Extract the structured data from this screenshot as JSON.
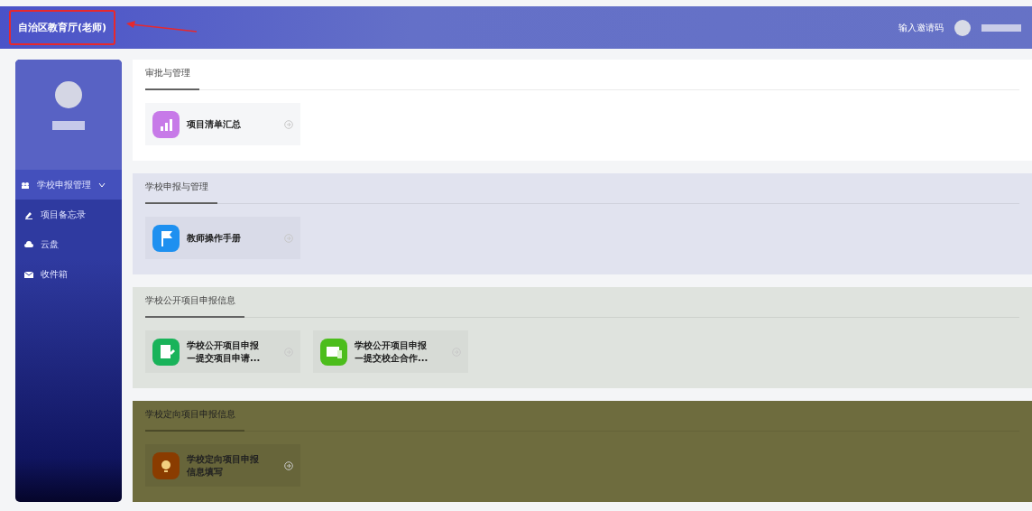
{
  "header": {
    "title": "自治区教育厅(老师)",
    "invite_link": "输入邀请码"
  },
  "sidebar": {
    "menu": [
      {
        "label": "学校申报管理",
        "kind": "group",
        "expanded": true
      },
      {
        "label": "项目备忘录",
        "kind": "memo"
      },
      {
        "label": "云盘",
        "kind": "cloud"
      },
      {
        "label": "收件箱",
        "kind": "mail"
      }
    ]
  },
  "sections": [
    {
      "title": "审批与管理",
      "cards": [
        {
          "kind": "chart",
          "color": "#c77ae8",
          "lines": [
            "项目清单汇总"
          ]
        }
      ]
    },
    {
      "title": "学校申报与管理",
      "cards": [
        {
          "kind": "flag",
          "color": "#1e90f0",
          "lines": [
            "教师操作手册"
          ]
        }
      ]
    },
    {
      "title": "学校公开项目申报信息",
      "cards": [
        {
          "kind": "doc",
          "color": "#19b35a",
          "lines": [
            "学校公开项目申报",
            "—提交项目申请..."
          ]
        },
        {
          "kind": "screen",
          "color": "#4cbd1c",
          "lines": [
            "学校公开项目申报",
            "—提交校企合作..."
          ]
        }
      ]
    },
    {
      "title": "学校定向项目申报信息",
      "cards": [
        {
          "kind": "bulb",
          "color": "#8a3c00",
          "lines": [
            "学校定向项目申报",
            "信息填写"
          ]
        }
      ]
    }
  ]
}
